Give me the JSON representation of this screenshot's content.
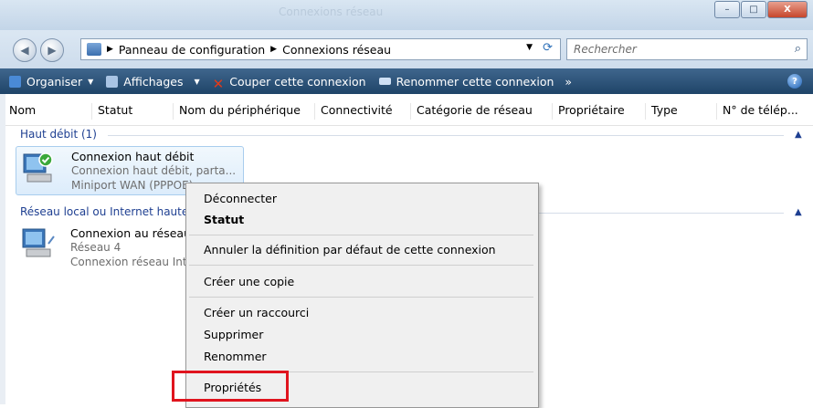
{
  "window": {
    "title": "Connexions réseau",
    "controls": {
      "minimize": "–",
      "maximize": "□",
      "close": "X"
    }
  },
  "address_bar": {
    "breadcrumb": [
      "Panneau de configuration",
      "Connexions réseau"
    ],
    "separator": "▶",
    "search_placeholder": "Rechercher"
  },
  "toolbar": {
    "items": [
      {
        "label": "Organiser",
        "has_arrow": true,
        "icon": "organize-icon",
        "color": "#4a8ad6"
      },
      {
        "label": "Affichages",
        "has_arrow": true,
        "icon": "views-icon",
        "color": "#a9c4e4"
      },
      {
        "label": "Couper cette connexion",
        "has_arrow": false,
        "icon": "disconnect-icon",
        "color": "#e03a1a"
      },
      {
        "label": "Renommer cette connexion",
        "has_arrow": false,
        "icon": "rename-icon",
        "color": "#cfe0f4"
      }
    ],
    "more": "»",
    "help": "?"
  },
  "columns": [
    "Nom",
    "Statut",
    "Nom du périphérique",
    "Connectivité",
    "Catégorie de réseau",
    "Propriétaire",
    "Type",
    "N° de télép..."
  ],
  "groups": [
    {
      "label": "Haut débit (1)",
      "items": [
        {
          "name": "Connexion haut débit",
          "lines": [
            "Connexion haut débit, parta...",
            "Miniport WAN (PPPOE)"
          ],
          "selected": true
        }
      ]
    },
    {
      "label": "Réseau local ou Internet haute vitesse",
      "items": [
        {
          "name": "Connexion au réseau local",
          "lines": [
            "Réseau  4",
            "Connexion réseau Intel(R)"
          ],
          "selected": false
        }
      ]
    }
  ],
  "context_menu": {
    "items": [
      "Déconnecter",
      "Statut",
      "Annuler la définition par défaut de cette connexion",
      "Créer une copie",
      "Créer un raccourci",
      "Supprimer",
      "Renommer",
      "Propriétés"
    ],
    "bold_item": "Statut",
    "highlighted_item": "Propriétés",
    "highlight_color": "#e0141e"
  }
}
